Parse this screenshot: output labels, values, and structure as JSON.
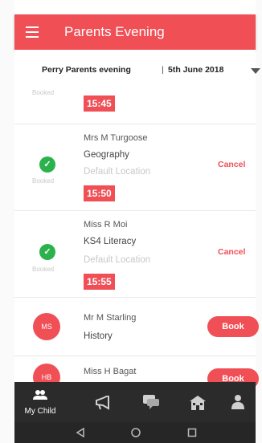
{
  "app": {
    "title": "Parents Evening"
  },
  "event": {
    "name": "Perry Parents evening",
    "separator": "|",
    "date": "5th June 2018"
  },
  "appointments": [
    {
      "status": "Booked",
      "time": "15:45"
    },
    {
      "status": "Booked",
      "teacher": "Mrs M Turgoose",
      "subject": "Geography",
      "location": "Default Location",
      "time": "15:50",
      "action": "Cancel"
    },
    {
      "status": "Booked",
      "teacher": "Miss R Moi",
      "subject": "KS4 Literacy",
      "location": "Default Location",
      "time": "15:55",
      "action": "Cancel"
    },
    {
      "initials": "MS",
      "teacher": "Mr M Starling",
      "subject": "History",
      "action": "Book"
    },
    {
      "initials": "HB",
      "teacher": "Miss H Bagat",
      "action": "Book"
    }
  ],
  "bottom_nav": [
    {
      "label": "My Child",
      "icon": "people-icon",
      "active": true
    },
    {
      "label": "",
      "icon": "megaphone-icon"
    },
    {
      "label": "",
      "icon": "chat-icon"
    },
    {
      "label": "",
      "icon": "school-icon"
    },
    {
      "label": "",
      "icon": "person-icon"
    }
  ],
  "system_nav": [
    "back-icon",
    "home-icon",
    "recents-icon"
  ],
  "colors": {
    "accent": "#ef4f55",
    "success": "#2bb24c",
    "nav_background": "#2b2b2b"
  }
}
